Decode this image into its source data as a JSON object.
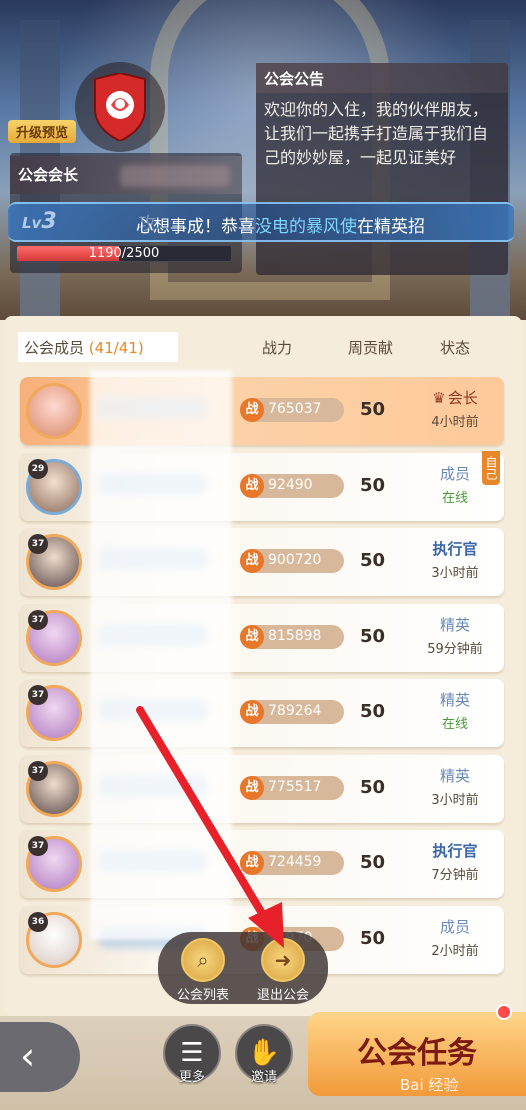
{
  "header": {
    "upgrade_preview": "升级预览",
    "leader_label": "公会会长",
    "notice_title": "公会公告",
    "notice_body": "欢迎你的入住，我的伙伴朋友，让我们一起携手打造属于我们自己的妙妙屋，一起见证美好",
    "marquee": {
      "level_prefix": "Lv",
      "level": "3",
      "ghost": "攻",
      "text_before": "心想事成！恭喜",
      "highlight": "没电的暴风使",
      "text_after": "在精英招"
    },
    "exp_text": "1190/2500",
    "exp_fraction": 0.476
  },
  "table": {
    "members_label": "公会成员",
    "members_count": "(41/41)",
    "col_power": "战力",
    "col_contrib": "周贡献",
    "col_status": "状态",
    "zhan": "战",
    "self_tag": "自己",
    "rows": [
      {
        "level": "",
        "power": "765037",
        "contrib": "50",
        "role": "会长",
        "status": "4小时前"
      },
      {
        "level": "29",
        "power": "92490",
        "contrib": "50",
        "role": "成员",
        "status": "在线"
      },
      {
        "level": "37",
        "power": "900720",
        "contrib": "50",
        "role": "执行官",
        "status": "3小时前"
      },
      {
        "level": "37",
        "power": "815898",
        "contrib": "50",
        "role": "精英",
        "status": "59分钟前"
      },
      {
        "level": "37",
        "power": "789264",
        "contrib": "50",
        "role": "精英",
        "status": "在线"
      },
      {
        "level": "37",
        "power": "775517",
        "contrib": "50",
        "role": "精英",
        "status": "3小时前"
      },
      {
        "level": "37",
        "power": "724459",
        "contrib": "50",
        "role": "执行官",
        "status": "7分钟前"
      },
      {
        "level": "36",
        "power": "71970",
        "contrib": "50",
        "role": "成员",
        "status": "2小时前"
      }
    ]
  },
  "popup": {
    "guild_list": "公会列表",
    "leave_guild": "退出公会"
  },
  "bottom": {
    "more": "更多",
    "invite": "邀请",
    "task": "公会任务",
    "watermark": "Bai 经验"
  },
  "colors": {
    "accent": "#e8872a",
    "arrow": "#e8202a"
  }
}
